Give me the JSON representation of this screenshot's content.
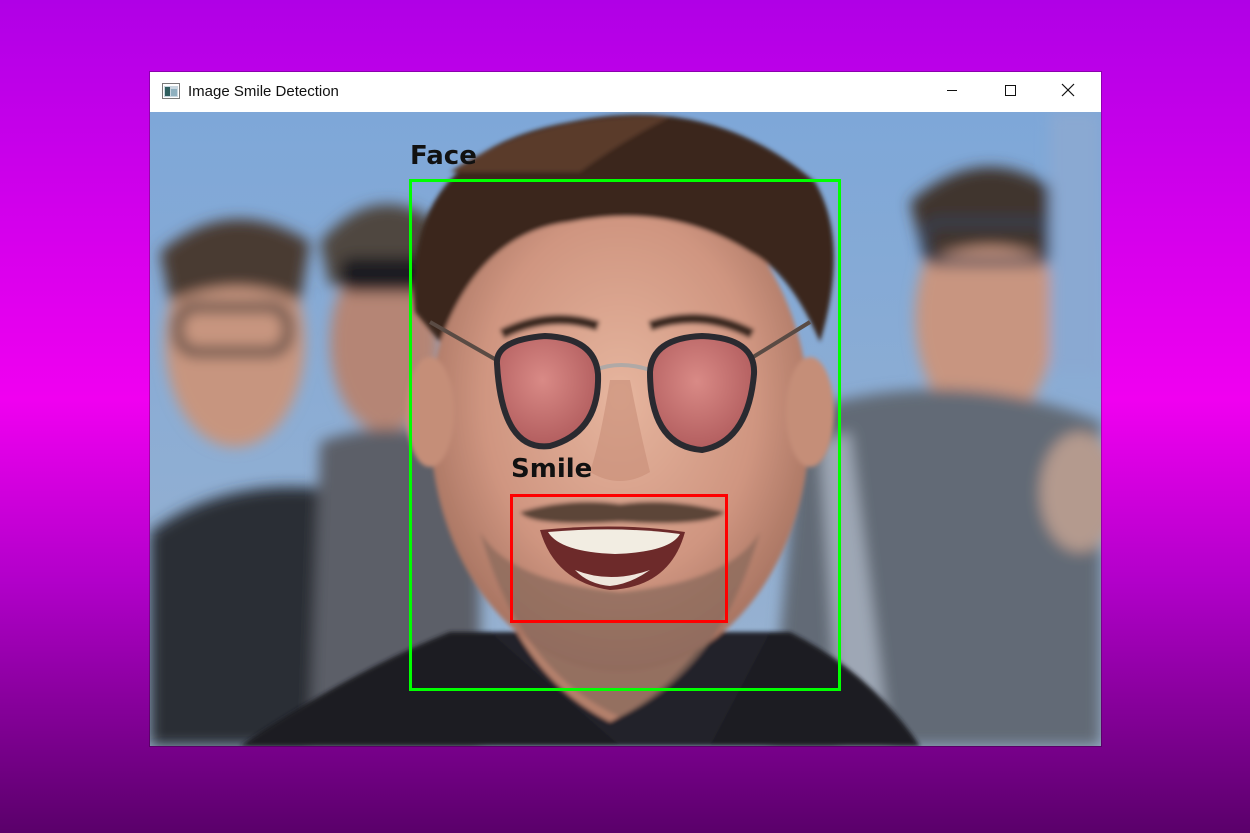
{
  "window": {
    "title": "Image Smile Detection"
  },
  "icons": {
    "app": "image-window-icon",
    "minimize": "minimize-icon",
    "maximize": "maximize-icon",
    "close": "close-icon"
  },
  "detections": [
    {
      "label": "Face",
      "color": "#00ff00"
    },
    {
      "label": "Smile",
      "color": "#ff0000"
    }
  ]
}
